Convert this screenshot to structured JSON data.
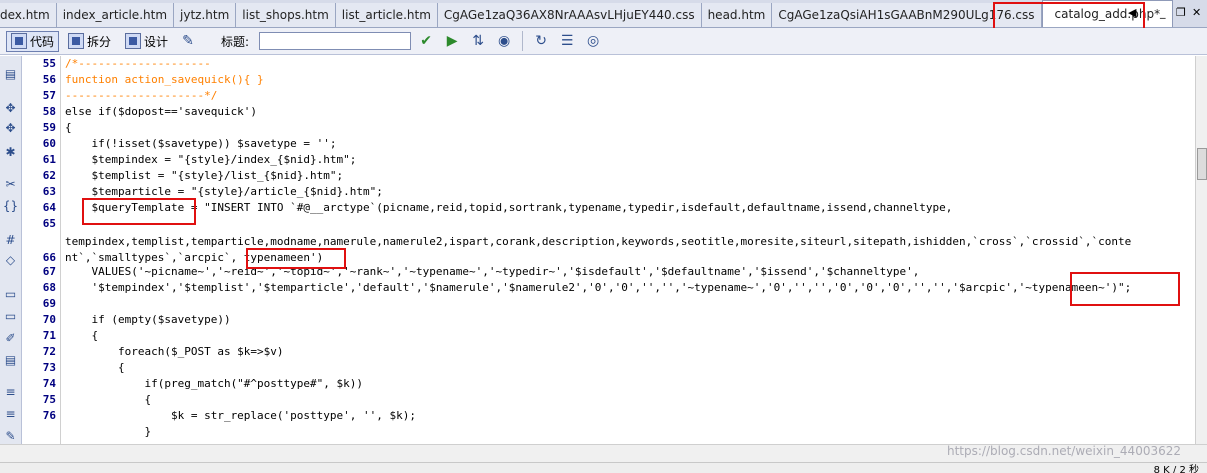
{
  "tabs": [
    {
      "label": "dex.htm"
    },
    {
      "label": "index_article.htm"
    },
    {
      "label": "jytz.htm"
    },
    {
      "label": "list_shops.htm"
    },
    {
      "label": "list_article.htm"
    },
    {
      "label": "CgAGe1zaQ36AX8NrAAAsvLHjuEY440.css"
    },
    {
      "label": "head.htm"
    },
    {
      "label": "CgAGe1zaQsiAH1sGAABnM290ULg176.css"
    }
  ],
  "active_tab": "catalog_add.php*",
  "toolbar": {
    "code_label": "代码",
    "split_label": "拆分",
    "design_label": "设计",
    "title_label": "标题:",
    "title_value": ""
  },
  "line_numbers": [
    "55",
    "56",
    "57",
    "58",
    "59",
    "60",
    "61",
    "62",
    "63",
    "64",
    "65",
    "",
    "66",
    "67",
    "68",
    "69",
    "70",
    "71",
    "72",
    "73",
    "74",
    "75",
    "76"
  ],
  "code_lines": [
    "/*--------------------",
    "function action_savequick(){ }",
    "---------------------*/",
    "else if($dopost=='savequick')",
    "{",
    "    if(!isset($savetype)) $savetype = '';",
    "    $tempindex = \"{style}/index_{$nid}.htm\";",
    "    $templist = \"{style}/list_{$nid}.htm\";",
    "    $temparticle = \"{style}/article_{$nid}.htm\";",
    "    $queryTemplate = \"INSERT INTO `#@__arctype`(picname,reid,topid,sortrank,typename,typedir,isdefault,defaultname,issend,channeltype,",
    "",
    "tempindex,templist,temparticle,modname,namerule,namerule2,ispart,corank,description,keywords,seotitle,moresite,siteurl,sitepath,ishidden,`cross`,`crossid`,`conte",
    "nt`,`smalltypes`,`arcpic`, typenameen')",
    "    VALUES('~picname~','~reid~','~topid~','~rank~','~typename~','~typedir~','$isdefault','$defaultname','$issend','$channeltype',",
    "    '$tempindex','$templist','$temparticle','default','$namerule','$namerule2','0','0','','','~typename~','0','','','0','0','0','','','$arcpic','~typenameen~')\";",
    "",
    "    if (empty($savetype))",
    "    {",
    "        foreach($_POST as $k=>$v)",
    "        {",
    "            if(preg_match(\"#^posttype#\", $k))",
    "            {",
    "                $k = str_replace('posttype', '', $k);",
    "            }"
  ],
  "watermark": "https://blog.csdn.net/weixin_44003622",
  "status": "8 K / 2 秒",
  "colors": {
    "comment": "#ff8000",
    "keyword": "#008000",
    "variable": "#000080",
    "string": "#a00000",
    "annotation": "#e01010"
  }
}
